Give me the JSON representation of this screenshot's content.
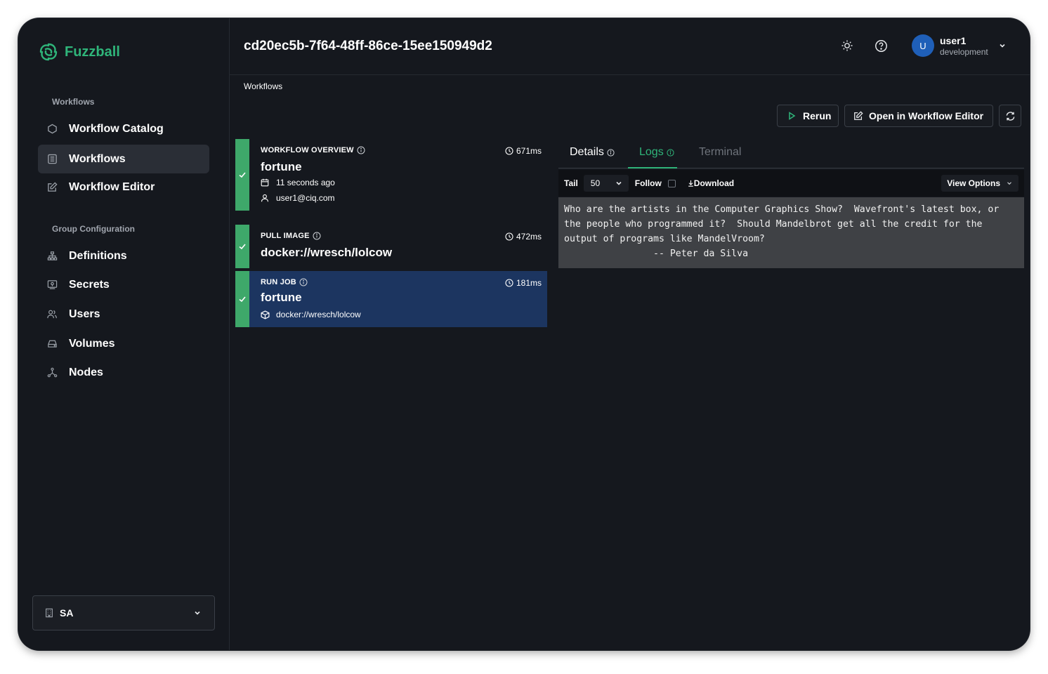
{
  "app": {
    "name": "Fuzzball"
  },
  "sidebar": {
    "sections": [
      {
        "title": "Workflows",
        "items": [
          {
            "label": "Workflow Catalog"
          },
          {
            "label": "Workflows"
          },
          {
            "label": "Workflow Editor"
          }
        ]
      },
      {
        "title": "Group Configuration",
        "items": [
          {
            "label": "Definitions"
          },
          {
            "label": "Secrets"
          },
          {
            "label": "Users"
          },
          {
            "label": "Volumes"
          },
          {
            "label": "Nodes"
          }
        ]
      }
    ],
    "active_item": "Workflows",
    "org_selector": {
      "value": "SA"
    }
  },
  "header": {
    "title": "cd20ec5b-7f64-48ff-86ce-15ee150949d2",
    "user": {
      "initial": "U",
      "name": "user1",
      "environment": "development"
    }
  },
  "breadcrumb": "Workflows",
  "actions": {
    "rerun": "Rerun",
    "open_editor": "Open in Workflow Editor"
  },
  "stages": [
    {
      "label": "WORKFLOW OVERVIEW",
      "title": "fortune",
      "duration": "671ms",
      "time": "11 seconds ago",
      "user": "user1@ciq.com",
      "status": "success"
    },
    {
      "label": "PULL IMAGE",
      "title": "docker://wresch/lolcow",
      "duration": "472ms",
      "status": "success"
    },
    {
      "label": "RUN JOB",
      "title": "fortune",
      "duration": "181ms",
      "image": "docker://wresch/lolcow",
      "status": "success",
      "selected": true
    }
  ],
  "tabs": [
    {
      "label": "Details"
    },
    {
      "label": "Logs"
    },
    {
      "label": "Terminal"
    }
  ],
  "active_tab": "Logs",
  "log_toolbar": {
    "tail_label": "Tail",
    "tail_value": "50",
    "follow_label": "Follow",
    "download_label": "Download",
    "view_options_label": "View Options"
  },
  "log_output": "Who are the artists in the Computer Graphics Show?  Wavefront's latest box, or\nthe people who programmed it?  Should Mandelbrot get all the credit for the\noutput of programs like MandelVroom?\n                -- Peter da Silva",
  "colors": {
    "brand": "#2fb57a",
    "success": "#3ea86a",
    "selected": "#1c3560",
    "background": "#15181e",
    "active_tab": "#2fb57a"
  }
}
